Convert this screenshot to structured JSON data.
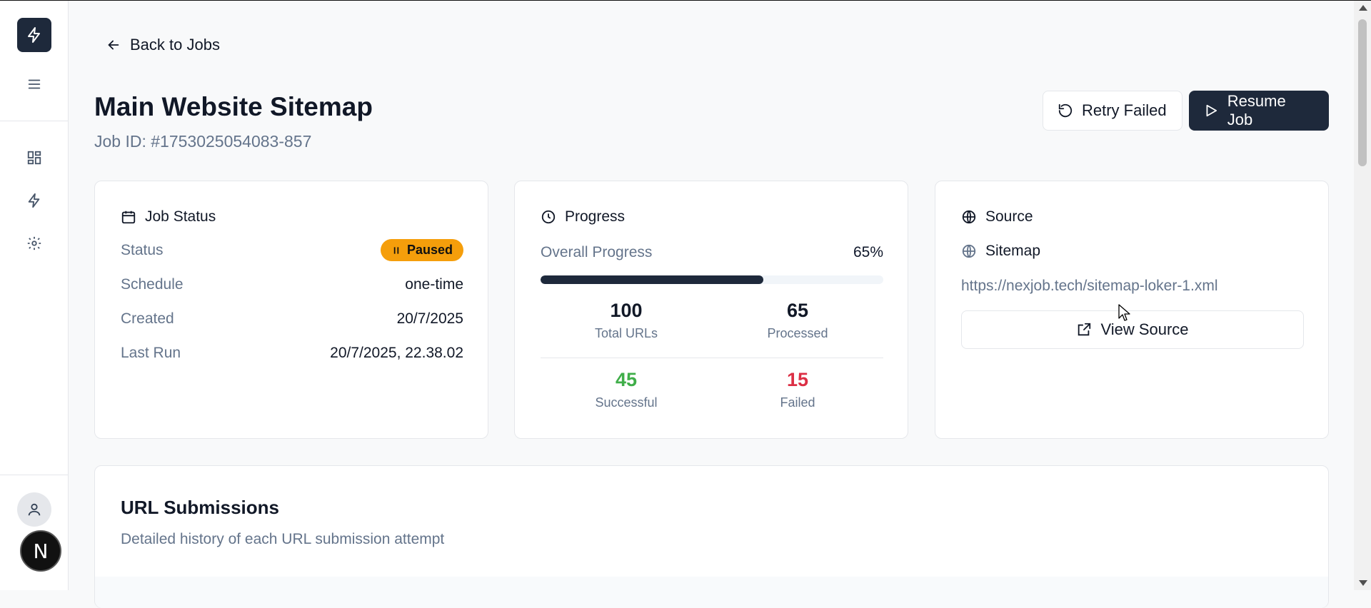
{
  "sidebar": {
    "logo_icon": "lightning-icon",
    "menu_icon": "hamburger-icon",
    "nav_icons": [
      "dashboard-icon",
      "lightning-icon",
      "gear-icon"
    ],
    "profile_icon": "user-icon",
    "badge_letter": "N"
  },
  "header": {
    "back_label": "Back to Jobs",
    "title": "Main Website Sitemap",
    "job_id": "Job ID: #1753025054083-857",
    "retry_label": "Retry Failed",
    "resume_label": "Resume Job"
  },
  "job_status": {
    "heading": "Job Status",
    "rows": [
      {
        "label": "Status",
        "value": "Paused"
      },
      {
        "label": "Schedule",
        "value": "one-time"
      },
      {
        "label": "Created",
        "value": "20/7/2025"
      },
      {
        "label": "Last Run",
        "value": "20/7/2025, 22.38.02"
      }
    ]
  },
  "progress": {
    "heading": "Progress",
    "overall_label": "Overall Progress",
    "overall_value": "65%",
    "fraction": 0.65,
    "stats": [
      {
        "num": "100",
        "cap": "Total URLs",
        "color": "#111827"
      },
      {
        "num": "65",
        "cap": "Processed",
        "color": "#111827"
      },
      {
        "num": "45",
        "cap": "Successful",
        "color": "#3fae49"
      },
      {
        "num": "15",
        "cap": "Failed",
        "color": "#dc2f45"
      }
    ]
  },
  "source": {
    "heading": "Source",
    "type": "Sitemap",
    "url": "https://nexjob.tech/sitemap-loker-1.xml",
    "view_label": "View Source"
  },
  "submissions": {
    "title": "URL Submissions",
    "description": "Detailed history of each URL submission attempt"
  },
  "colors": {
    "primary": "#1e293b",
    "paused": "#f59e0b",
    "success": "#3fae49",
    "fail": "#dc2f45",
    "muted": "#64748b"
  }
}
